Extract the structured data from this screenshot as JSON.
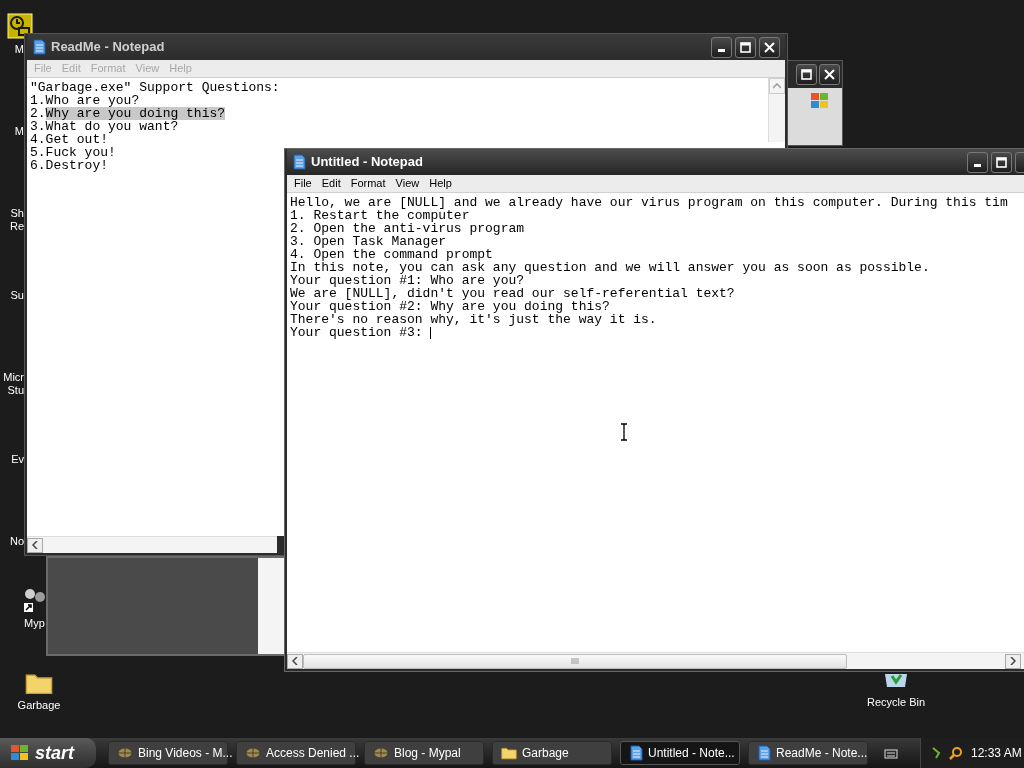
{
  "desktop_icons": [
    {
      "label_lines": [
        "M"
      ],
      "hidden": true
    },
    {
      "label_lines": [
        "M"
      ],
      "hidden": true
    },
    {
      "label_lines": [
        "Sh",
        "Re"
      ],
      "hidden": true
    },
    {
      "label_lines": [
        "Su"
      ],
      "hidden": true
    },
    {
      "label_lines": [
        "Micr",
        "Stu"
      ],
      "hidden": true
    },
    {
      "label_lines": [
        "Ev"
      ],
      "hidden": true
    },
    {
      "label_lines": [
        "No"
      ],
      "hidden": true
    },
    {
      "label_lines": [
        "Myp"
      ],
      "hidden": false,
      "kind": "shortcut"
    },
    {
      "label_lines": [
        "Garbage"
      ],
      "hidden": false,
      "kind": "folder"
    }
  ],
  "recycle_bin": {
    "label": "Recycle Bin"
  },
  "readme_window": {
    "title": "ReadMe - Notepad",
    "active": false,
    "menu": [
      "File",
      "Edit",
      "Format",
      "View",
      "Help"
    ],
    "heading": "\"Garbage.exe\" Support Questions:",
    "lines": [
      {
        "number": "1.",
        "text": "Who are you?",
        "selected": false
      },
      {
        "number": "2.",
        "text": "Why are you doing this?",
        "selected": true
      },
      {
        "number": "3.",
        "text": "What do you want?",
        "selected": false
      },
      {
        "number": "4.",
        "text": "Get out!",
        "selected": false
      },
      {
        "number": "5.",
        "text": "Fuck you!",
        "selected": false
      },
      {
        "number": "6.",
        "text": "Destroy!",
        "selected": false
      }
    ]
  },
  "untitled_window": {
    "title": "Untitled - Notepad",
    "active": true,
    "menu": [
      "File",
      "Edit",
      "Format",
      "View",
      "Help"
    ],
    "lines": [
      "Hello, we are [NULL] and we already have our virus program on this computer. During this tim",
      "1. Restart the computer",
      "2. Open the anti-virus program",
      "3. Open Task Manager",
      "4. Open the command prompt",
      "In this note, you can ask any question and we will answer you as soon as possible.",
      "Your question #1: Who are you?",
      "We are [NULL], didn't you read our self-referential text?",
      "Your question #2: Why are you doing this?",
      "There's no reason why, it's just the way it is.",
      "Your question #3: "
    ]
  },
  "taskbar": {
    "start": "start",
    "tasks": [
      {
        "label": "Bing Videos - M...",
        "kind": "browser",
        "selected": false
      },
      {
        "label": "Access Denied ...",
        "kind": "browser",
        "selected": false
      },
      {
        "label": "Blog - Mypal",
        "kind": "browser",
        "selected": false
      },
      {
        "label": "Garbage",
        "kind": "folder",
        "selected": false
      },
      {
        "label": "Untitled - Note...",
        "kind": "notepad",
        "selected": true
      },
      {
        "label": "ReadMe - Note...",
        "kind": "notepad",
        "selected": false
      }
    ],
    "clock": "12:33 AM"
  }
}
